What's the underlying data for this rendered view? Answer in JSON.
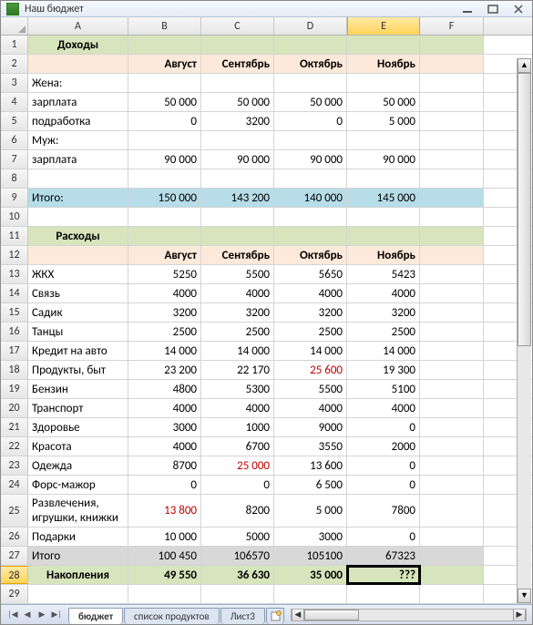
{
  "window": {
    "title": "Наш бюджет"
  },
  "columns": [
    "A",
    "B",
    "C",
    "D",
    "E",
    "F"
  ],
  "selected_column": "E",
  "selected_row": 28,
  "active_cell_value": "???",
  "tabs": {
    "items": [
      "бюджет",
      "список продуктов",
      "Лист3"
    ],
    "active": 0
  },
  "sections": {
    "income_header": "Доходы",
    "expense_header": "Расходы",
    "savings_header": "Накопления"
  },
  "months": {
    "aug": "Август",
    "sep": "Сентябрь",
    "oct": "Октябрь",
    "nov": "Ноябрь"
  },
  "income": {
    "wife_label": "Жена:",
    "wife_salary_label": "зарплата",
    "wife_salary": {
      "aug": "50 000",
      "sep": "50 000",
      "oct": "50 000",
      "nov": "50 000"
    },
    "wife_side_label": "подработка",
    "wife_side": {
      "aug": "0",
      "sep": "3200",
      "oct": "0",
      "nov": "5 000"
    },
    "husband_label": "Муж:",
    "husband_salary_label": "зарплата",
    "husband_salary": {
      "aug": "90 000",
      "sep": "90 000",
      "oct": "90 000",
      "nov": "90 000"
    },
    "total_label": "Итого:",
    "total": {
      "aug": "150 000",
      "sep": "143 200",
      "oct": "140 000",
      "nov": "145 000"
    }
  },
  "expenses": {
    "zhkh": {
      "label": "ЖКХ",
      "aug": "5250",
      "sep": "5500",
      "oct": "5650",
      "nov": "5423"
    },
    "svyaz": {
      "label": "Связь",
      "aug": "4000",
      "sep": "4000",
      "oct": "4000",
      "nov": "4000"
    },
    "sadik": {
      "label": "Садик",
      "aug": "3200",
      "sep": "3200",
      "oct": "3200",
      "nov": "3200"
    },
    "tancy": {
      "label": "Танцы",
      "aug": "2500",
      "sep": "2500",
      "oct": "2500",
      "nov": "2500"
    },
    "kredit": {
      "label": "Кредит на авто",
      "aug": "14 000",
      "sep": "14 000",
      "oct": "14 000",
      "nov": "14 000"
    },
    "produkty": {
      "label": "Продукты, быт",
      "aug": "23 200",
      "sep": "22 170",
      "oct": "25 600",
      "nov": "19 300",
      "oct_red": true
    },
    "benzin": {
      "label": "Бензин",
      "aug": "4800",
      "sep": "5300",
      "oct": "5500",
      "nov": "5100"
    },
    "transport": {
      "label": "Транспорт",
      "aug": "4000",
      "sep": "4000",
      "oct": "4000",
      "nov": "4000"
    },
    "zdorove": {
      "label": "Здоровье",
      "aug": "3000",
      "sep": "1000",
      "oct": "9000",
      "nov": "0"
    },
    "krasota": {
      "label": "Красота",
      "aug": "4000",
      "sep": "6700",
      "oct": "3550",
      "nov": "2000"
    },
    "odezhda": {
      "label": "Одежда",
      "aug": "8700",
      "sep": "25 000",
      "oct": "13 600",
      "nov": "0",
      "sep_red": true
    },
    "fors": {
      "label": "Форс-мажор",
      "aug": "0",
      "sep": "0",
      "oct": "6 500",
      "nov": "0"
    },
    "razvl": {
      "label": "Развлечения, игрушки, книжки",
      "aug": "13 800",
      "sep": "8200",
      "oct": "5 000",
      "nov": "7800",
      "aug_red": true
    },
    "podarki": {
      "label": "Подарки",
      "aug": "10 000",
      "sep": "5000",
      "oct": "3000",
      "nov": "0"
    },
    "total_label": "Итого",
    "total": {
      "aug": "100 450",
      "sep": "106570",
      "oct": "105100",
      "nov": "67323"
    }
  },
  "savings": {
    "aug": "49 550",
    "sep": "36 630",
    "oct": "35 000",
    "nov": "???"
  }
}
